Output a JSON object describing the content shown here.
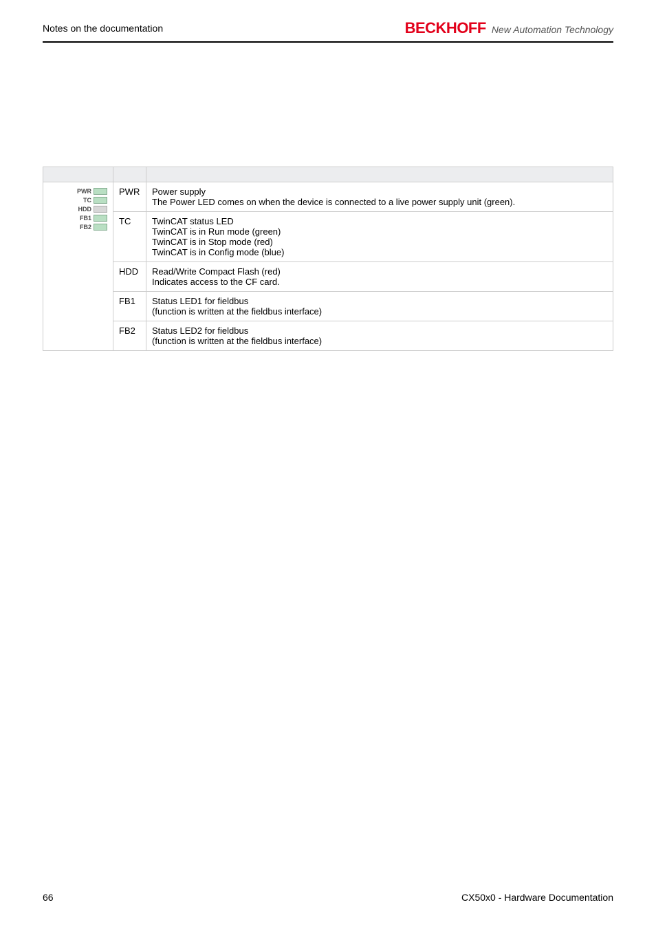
{
  "header": {
    "section": "Notes on the documentation",
    "brand": "BECKHOFF",
    "tagline": "New Automation Technology"
  },
  "table": {
    "panel_labels": [
      "PWR",
      "TC",
      "HDD",
      "FB1",
      "FB2"
    ],
    "rows": [
      {
        "abbr": "PWR",
        "lines": [
          "Power supply",
          "The Power LED comes on when the device is connected to a live power supply unit (green)."
        ]
      },
      {
        "abbr": "TC",
        "lines": [
          "TwinCAT status LED",
          "TwinCAT is in Run mode (green)",
          "TwinCAT is in Stop mode (red)",
          "TwinCAT is in Config mode (blue)"
        ]
      },
      {
        "abbr": "HDD",
        "lines": [
          "Read/Write Compact Flash (red)",
          "Indicates access to the CF card."
        ]
      },
      {
        "abbr": "FB1",
        "lines": [
          "Status LED1 for fieldbus",
          "(function is written at the fieldbus interface)"
        ]
      },
      {
        "abbr": "FB2",
        "lines": [
          "Status LED2 for fieldbus",
          "(function is written at the fieldbus interface)"
        ]
      }
    ]
  },
  "footer": {
    "page": "66",
    "doc": "CX50x0 - Hardware Documentation"
  }
}
